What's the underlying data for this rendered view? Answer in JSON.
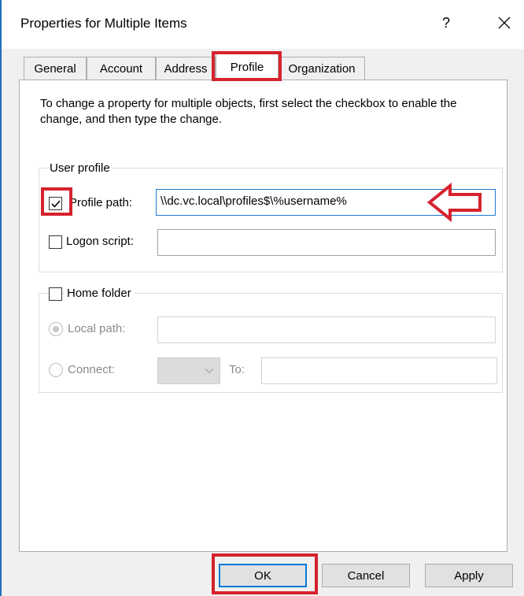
{
  "window": {
    "title": "Properties for Multiple Items",
    "help_label": "?"
  },
  "tabs": [
    {
      "label": "General"
    },
    {
      "label": "Account"
    },
    {
      "label": "Address"
    },
    {
      "label": "Profile"
    },
    {
      "label": "Organization"
    }
  ],
  "active_tab": "Profile",
  "instructions": "To change a property for multiple objects, first select the checkbox to enable the change, and then type the change.",
  "user_profile": {
    "group_label": "User profile",
    "profile_path": {
      "label": "Profile path:",
      "checked": true,
      "value": "\\\\dc.vc.local\\profiles$\\%username%"
    },
    "logon_script": {
      "label": "Logon script:",
      "checked": false,
      "value": ""
    }
  },
  "home_folder": {
    "group_label": "Home folder",
    "checked": false,
    "local_path": {
      "label": "Local path:",
      "selected": true,
      "value": ""
    },
    "connect": {
      "label": "Connect:",
      "selected": false,
      "drive": "",
      "to_label": "To:",
      "to_value": ""
    }
  },
  "buttons": {
    "ok": "OK",
    "cancel": "Cancel",
    "apply": "Apply"
  },
  "colors": {
    "annotation_red": "#d6222e",
    "focus_blue": "#1e78d3",
    "dialog_bg": "#f0f0f0"
  },
  "icons": [
    "close-icon",
    "checkmark-icon",
    "chevron-down-icon",
    "left-arrow-annotation"
  ]
}
